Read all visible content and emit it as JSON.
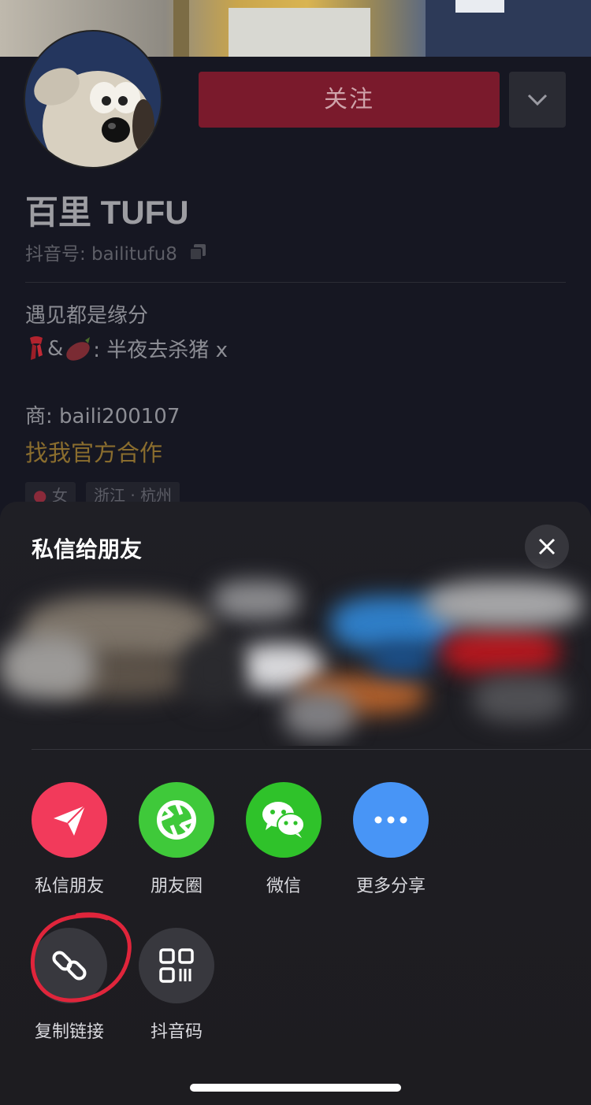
{
  "profile": {
    "follow_label": "关注",
    "nickname": "百里 TUFU",
    "douyin_id": "抖音号: bailitufu8",
    "bio_line1": "遇见都是缘分",
    "bio_line2_prefix": "&",
    "bio_line2_text": ": 半夜去杀猪 x",
    "bio_line3": "商: baili200107",
    "cooperate_link": "找我官方合作",
    "tags": [
      "女",
      "浙江 · 杭州"
    ]
  },
  "share_sheet": {
    "title": "私信给朋友",
    "row1": [
      {
        "label": "私信朋友",
        "icon": "paper-plane-icon",
        "color": "#f23a5b"
      },
      {
        "label": "朋友圈",
        "icon": "aperture-icon",
        "color": "#3fc93a"
      },
      {
        "label": "微信",
        "icon": "wechat-icon",
        "color": "#2fc22a"
      },
      {
        "label": "更多分享",
        "icon": "more-dots-icon",
        "color": "#4895f6"
      }
    ],
    "row2": [
      {
        "label": "复制链接",
        "icon": "link-icon",
        "color": "#38383e"
      },
      {
        "label": "抖音码",
        "icon": "qr-code-icon",
        "color": "#38383e"
      }
    ],
    "annotation_color": "#e0253b"
  }
}
